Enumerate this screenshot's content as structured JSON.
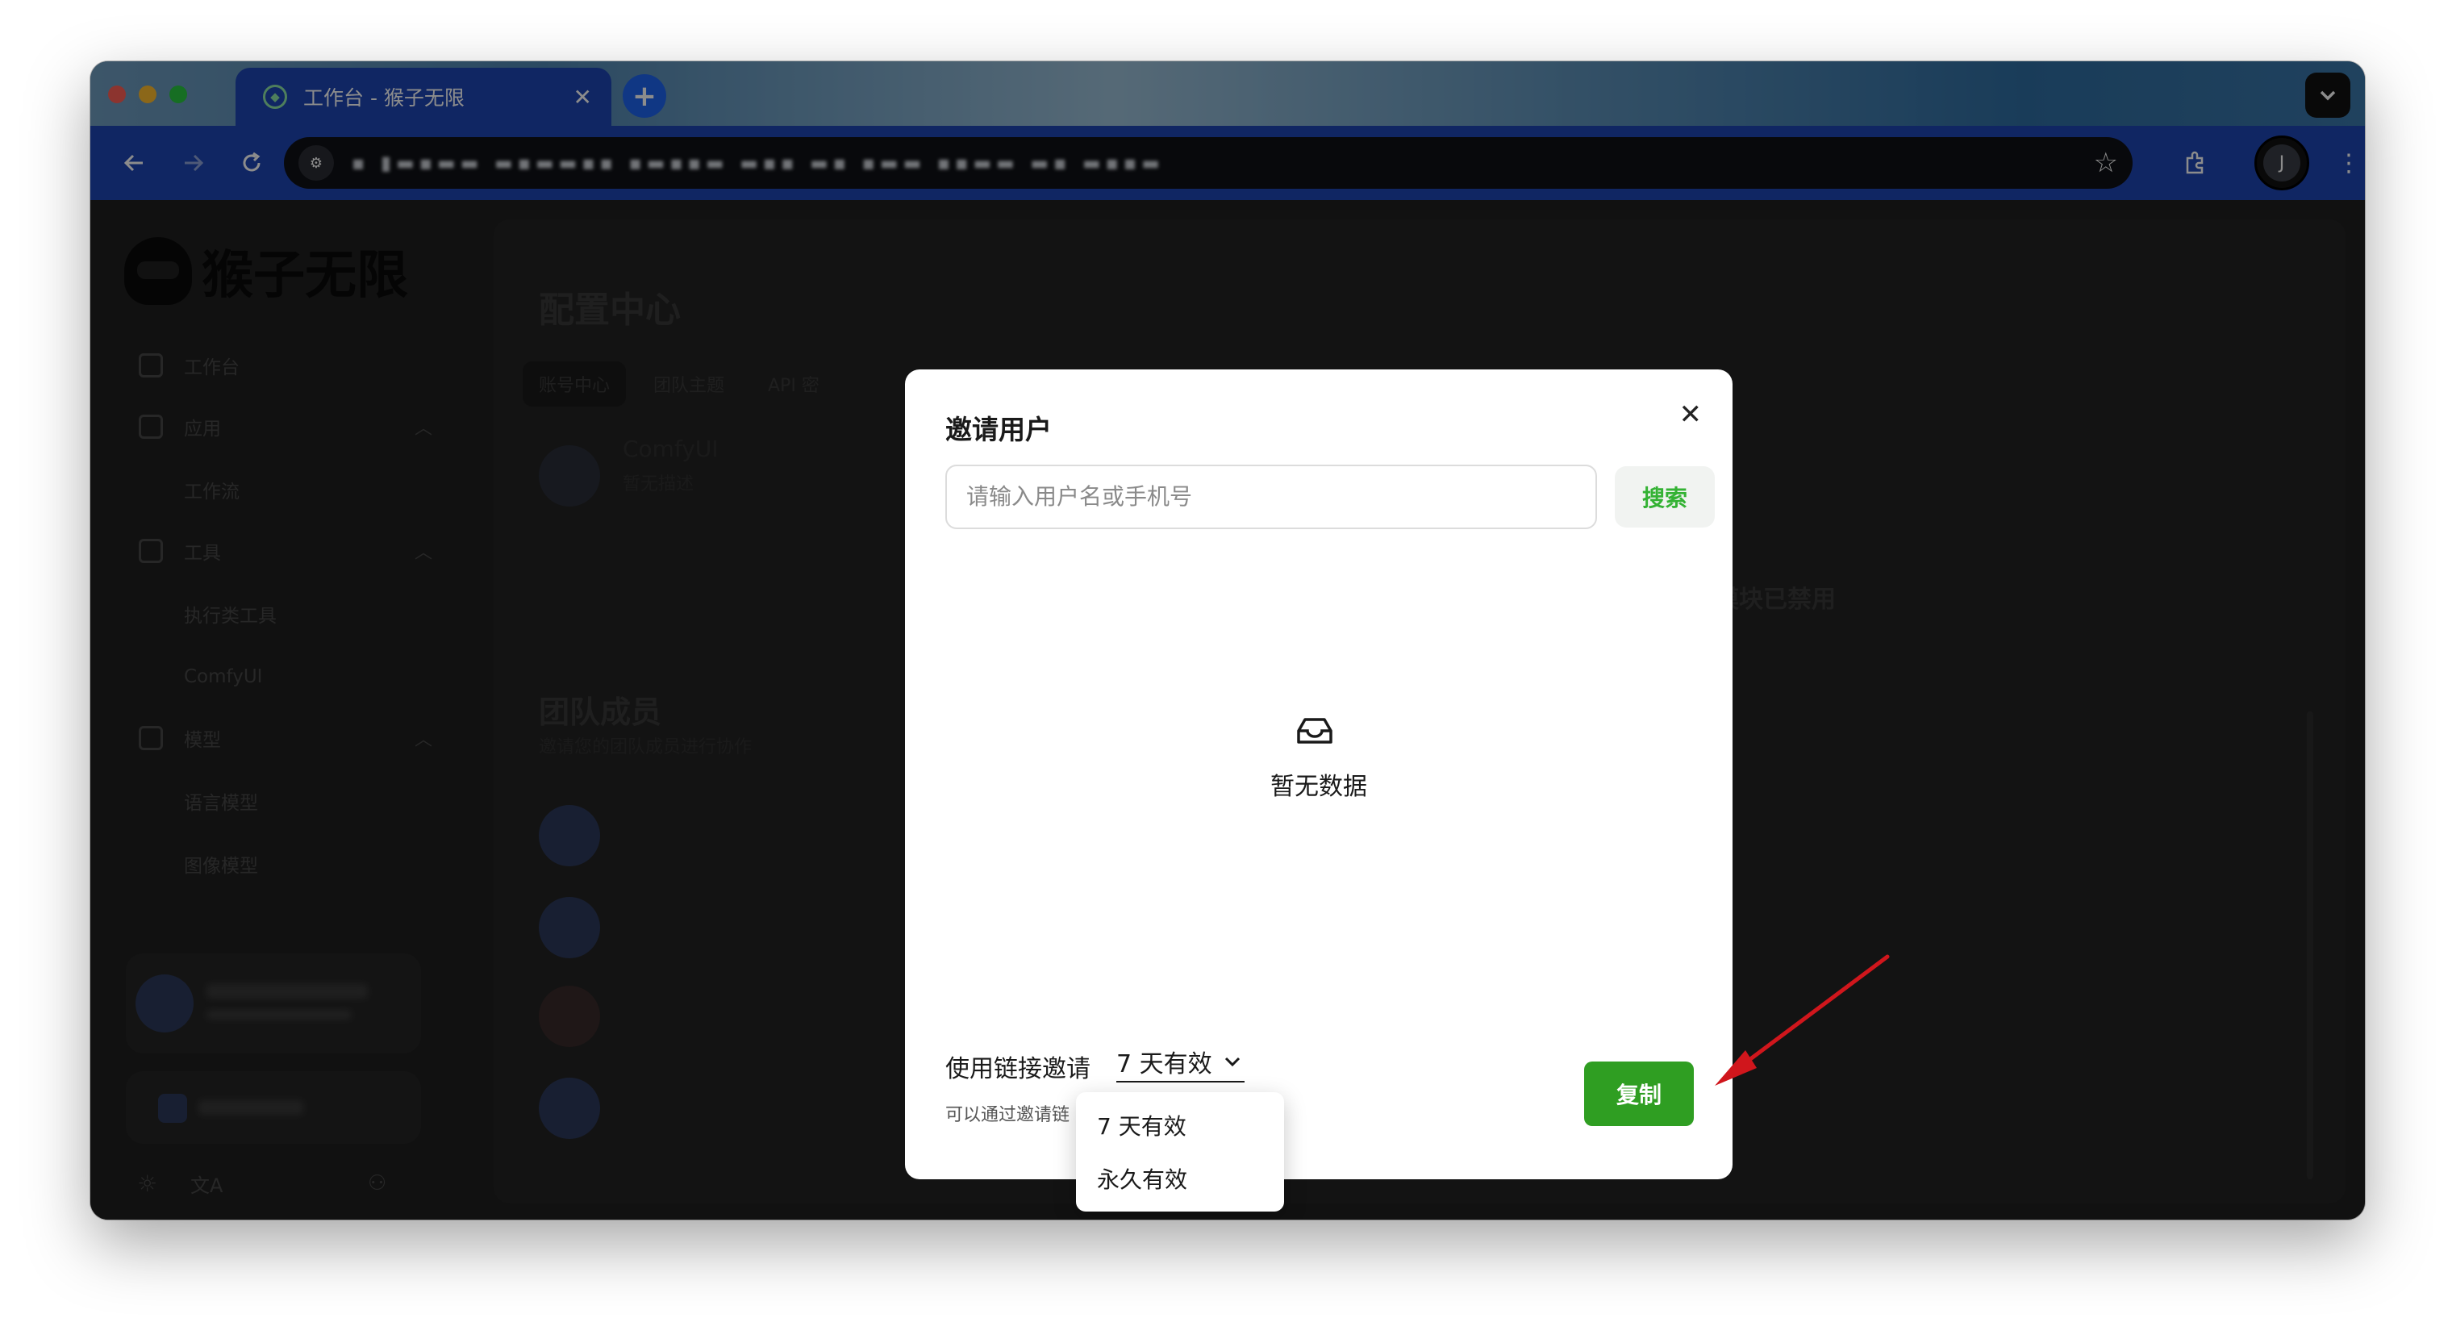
{
  "browser": {
    "tab_title": "工作台 - 猴子无限",
    "tab_close": "✕",
    "new_tab": "+",
    "url_masked": "▪ ▮▬▪▬▬ ▬▪▬▬▪▪ ▪▬▪▪▬ ▬▪▪ ▬▪ ▪▬▬ ▪▪▬▬ ▬▪ ▬▪▪▬"
  },
  "profile_initial": "J",
  "brand": "猴子无限",
  "sidebar": {
    "items": [
      {
        "label": "工作台"
      },
      {
        "label": "应用"
      },
      {
        "label": "工作流"
      },
      {
        "label": "工具"
      },
      {
        "label": "执行类工具"
      },
      {
        "label": "ComfyUI"
      },
      {
        "label": "模型"
      },
      {
        "label": "语言模型"
      },
      {
        "label": "图像模型"
      }
    ]
  },
  "page": {
    "title": "配置中心",
    "tabs": [
      "账号中心",
      "团队主题",
      "API 密"
    ],
    "app_name": "ComfyUI",
    "app_desc": "暂无描述",
    "members_title": "团队成员",
    "members_desc": "邀请您的团队成员进行协作",
    "payment_disabled": "支付模块已禁用"
  },
  "modal": {
    "title": "邀请用户",
    "search_placeholder": "请输入用户名或手机号",
    "search_button": "搜索",
    "empty_text": "暂无数据",
    "link_label": "使用链接邀请",
    "selected_validity": "7 天有效",
    "hint": "可以通过邀请链",
    "copy_button": "复制",
    "options": [
      "7 天有效",
      "永久有效"
    ]
  },
  "colors": {
    "accent_green": "#2f9e22",
    "browser_blue": "#1e46b4",
    "annotation_red": "#d0161c"
  }
}
